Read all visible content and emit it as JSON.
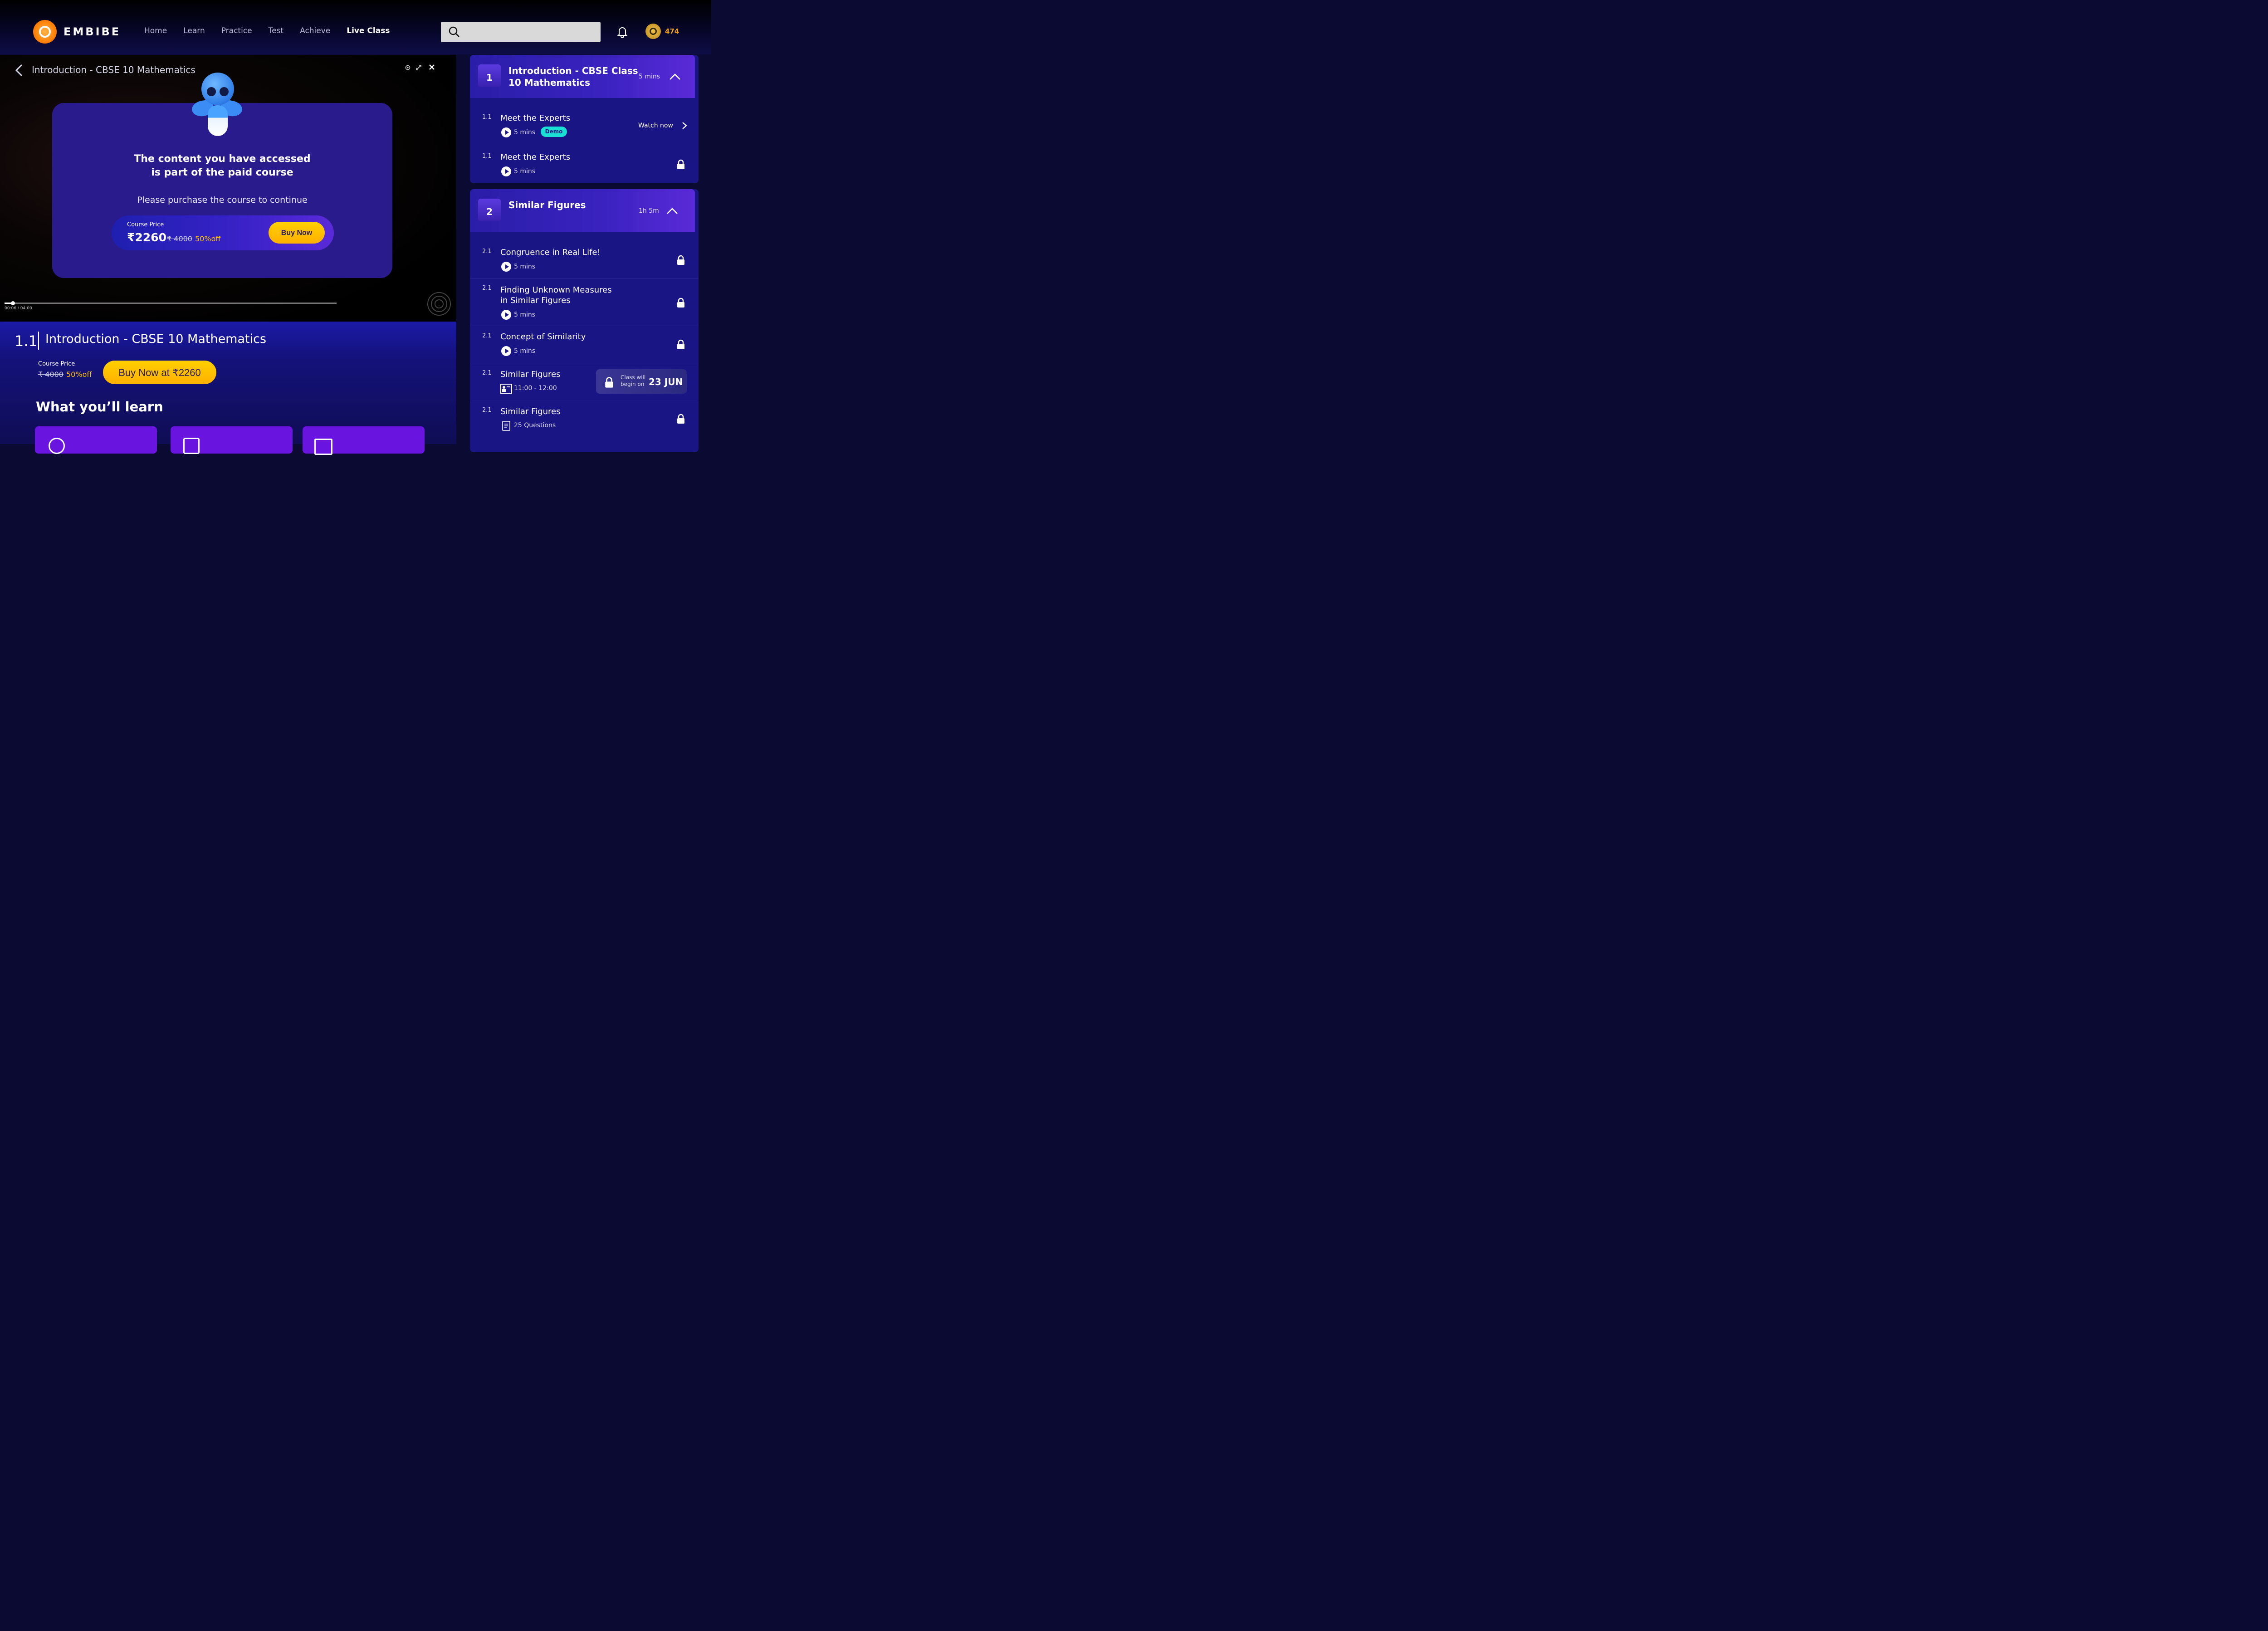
{
  "header": {
    "brand": "EMBIBE",
    "nav": [
      "Home",
      "Learn",
      "Practice",
      "Test",
      "Achieve",
      "Live Class"
    ],
    "active_nav": "Live Class",
    "search_placeholder": "",
    "coins": "474",
    "colors": {
      "accent": "#ffc400",
      "brand": "#ff7a00"
    }
  },
  "player": {
    "title": "Introduction - CBSE 10 Mathematics",
    "time_current": "00:06",
    "time_sep": "/",
    "time_total": "04:00",
    "progress": 0.025
  },
  "paywall": {
    "headline_1": "The content you have accessed",
    "headline_2": "is part of the paid course",
    "subtext": "Please purchase the course to continue",
    "price_label": "Course Price",
    "price": "₹2260",
    "old_price": "₹ 4000",
    "discount": "50%off",
    "buy_label": "Buy Now"
  },
  "lesson": {
    "number": "1.1",
    "title": "Introduction - CBSE 10 Mathematics",
    "price_label": "Course Price",
    "old_price": "₹ 4000",
    "discount": "50%off",
    "buy_label": "Buy Now at ₹2260",
    "learn_heading": "What you’ll learn"
  },
  "sidebar": {
    "sections": [
      {
        "number": "1",
        "title_1": "Introduction - CBSE Class",
        "title_2": "10 Mathematics",
        "time": "5 mins",
        "items": [
          {
            "num": "1.1",
            "title": "Meet the Experts",
            "meta": "5 mins",
            "badge": "Demo",
            "action": "Watch now"
          },
          {
            "num": "1.1",
            "title": "Meet the Experts",
            "meta": "5 mins"
          }
        ]
      },
      {
        "number": "2",
        "title_1": "Similar Figures",
        "time": "1h 5m",
        "items": [
          {
            "num": "2.1",
            "title": "Congruence in Real Life!",
            "meta": "5 mins"
          },
          {
            "num": "2.1",
            "title_1": "Finding Unknown Measures",
            "title_2": "in Similar Figures",
            "meta": "5 mins"
          },
          {
            "num": "2.1",
            "title": "Concept of Similarity",
            "meta": "5 mins"
          },
          {
            "num": "2.1",
            "title": "Similar Figures",
            "meta": "11:00 - 12:00",
            "class_text_1": "Class will",
            "class_text_2": "begin on",
            "class_date": "23 JUN"
          },
          {
            "num": "2.1",
            "title": "Similar Figures",
            "meta": "25 Questions"
          }
        ]
      }
    ]
  }
}
